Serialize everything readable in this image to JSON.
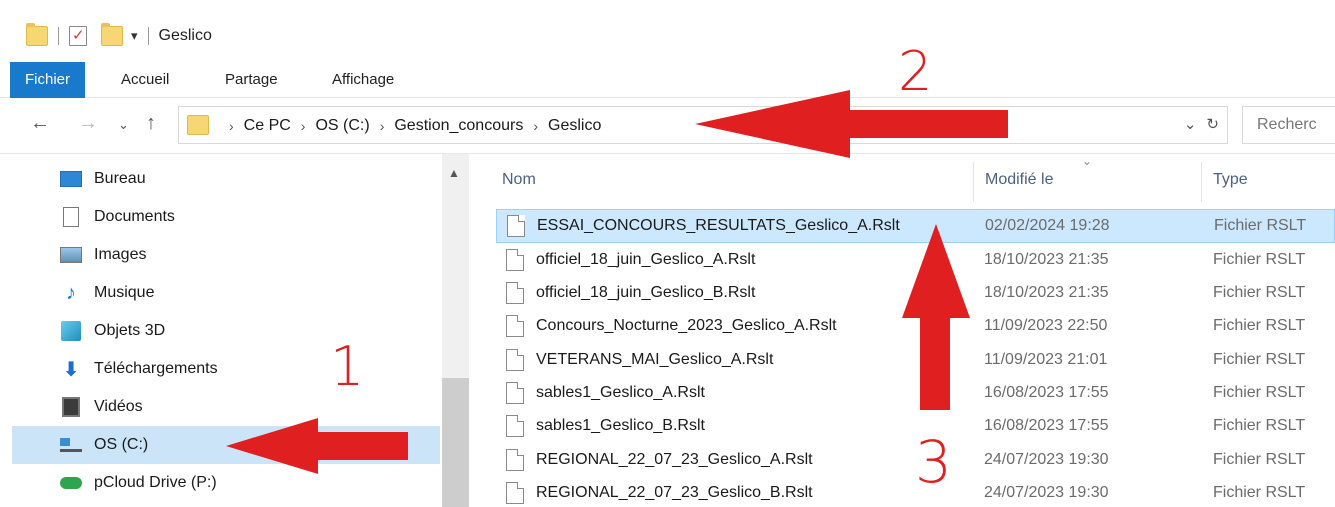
{
  "window": {
    "title": "Geslico"
  },
  "ribbon": {
    "tabs": [
      {
        "label": "Fichier",
        "active": true
      },
      {
        "label": "Accueil"
      },
      {
        "label": "Partage"
      },
      {
        "label": "Affichage"
      }
    ]
  },
  "address": {
    "crumbs": [
      "Ce PC",
      "OS (C:)",
      "Gestion_concours",
      "Geslico"
    ],
    "search_placeholder": "Recherc"
  },
  "sidebar": {
    "items": [
      {
        "label": "Bureau",
        "icon": "desktop-icon"
      },
      {
        "label": "Documents",
        "icon": "documents-icon"
      },
      {
        "label": "Images",
        "icon": "pictures-icon"
      },
      {
        "label": "Musique",
        "icon": "music-icon"
      },
      {
        "label": "Objets 3D",
        "icon": "3d-objects-icon"
      },
      {
        "label": "Téléchargements",
        "icon": "downloads-icon"
      },
      {
        "label": "Vidéos",
        "icon": "videos-icon"
      },
      {
        "label": "OS (C:)",
        "icon": "drive-icon",
        "selected": true
      },
      {
        "label": "pCloud Drive (P:)",
        "icon": "cloud-drive-icon"
      }
    ]
  },
  "filelist": {
    "columns": {
      "name": "Nom",
      "modified": "Modifié le",
      "type": "Type"
    },
    "rows": [
      {
        "name": "ESSAI_CONCOURS_RESULTATS_Geslico_A.Rslt",
        "modified": "02/02/2024 19:28",
        "type": "Fichier RSLT",
        "selected": true
      },
      {
        "name": "officiel_18_juin_Geslico_A.Rslt",
        "modified": "18/10/2023 21:35",
        "type": "Fichier RSLT"
      },
      {
        "name": "officiel_18_juin_Geslico_B.Rslt",
        "modified": "18/10/2023 21:35",
        "type": "Fichier RSLT"
      },
      {
        "name": "Concours_Nocturne_2023_Geslico_A.Rslt",
        "modified": "11/09/2023 22:50",
        "type": "Fichier RSLT"
      },
      {
        "name": "VETERANS_MAI_Geslico_A.Rslt",
        "modified": "11/09/2023 21:01",
        "type": "Fichier RSLT"
      },
      {
        "name": "sables1_Geslico_A.Rslt",
        "modified": "16/08/2023 17:55",
        "type": "Fichier RSLT"
      },
      {
        "name": "sables1_Geslico_B.Rslt",
        "modified": "16/08/2023 17:55",
        "type": "Fichier RSLT"
      },
      {
        "name": "REGIONAL_22_07_23_Geslico_A.Rslt",
        "modified": "24/07/2023 19:30",
        "type": "Fichier RSLT"
      },
      {
        "name": "REGIONAL_22_07_23_Geslico_B.Rslt",
        "modified": "24/07/2023 19:30",
        "type": "Fichier RSLT"
      }
    ]
  },
  "annotations": {
    "one": "1",
    "two": "2",
    "three": "3",
    "color": "#e02020"
  }
}
